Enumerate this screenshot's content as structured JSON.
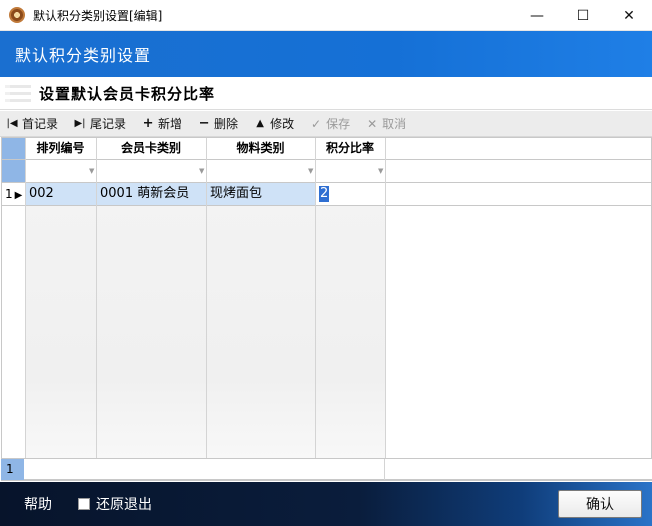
{
  "window": {
    "title": "默认积分类别设置[编辑]",
    "controls": {
      "minimize": "—",
      "maximize": "☐",
      "close": "✕"
    }
  },
  "header": {
    "title": "默认积分类别设置"
  },
  "section": {
    "title": "设置默认会员卡积分比率"
  },
  "toolbar": {
    "first": "首记录",
    "last": "尾记录",
    "add": "新增",
    "delete": "删除",
    "edit": "修改",
    "save": "保存",
    "cancel": "取消"
  },
  "grid": {
    "columns": [
      "排列编号",
      "会员卡类别",
      "物料类别",
      "积分比率"
    ],
    "rows": [
      {
        "index": "1",
        "seq": "002",
        "card_type": "0001 萌新会员",
        "material": "现烤面包",
        "ratio": "2"
      }
    ],
    "footer_count": "1"
  },
  "bottom": {
    "help": "帮助",
    "restore_exit": "还原退出",
    "confirm": "确认"
  },
  "colors": {
    "header_blue": "#1a6fd0",
    "selection": "#cfe2f7",
    "indicator": "#8fb6e6",
    "bottom_dark": "#07142b"
  }
}
